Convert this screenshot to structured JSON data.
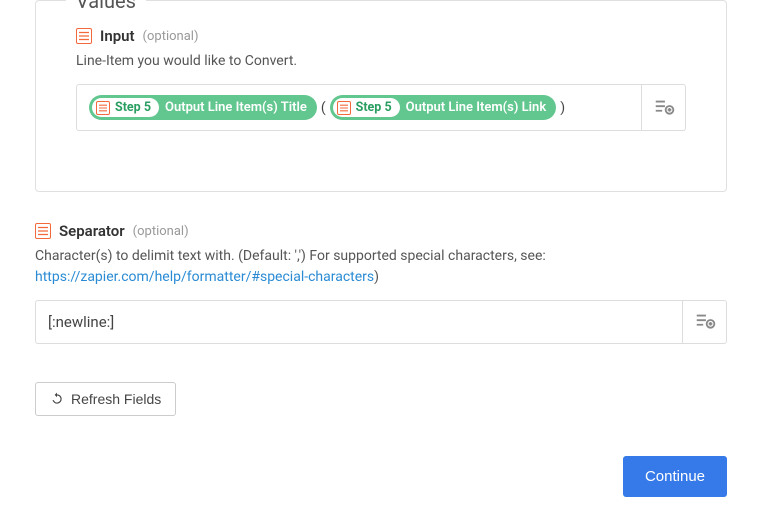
{
  "fieldset": {
    "legend": "Values"
  },
  "input_field": {
    "label": "Input",
    "optional": "(optional)",
    "description": "Line-Item you would like to Convert.",
    "tokens": [
      {
        "step": "Step 5",
        "label": "Output Line Item(s) Title"
      },
      {
        "step": "Step 5",
        "label": "Output Line Item(s) Link"
      }
    ],
    "open_paren": "(",
    "close_paren": ")"
  },
  "separator_field": {
    "label": "Separator",
    "optional": "(optional)",
    "description_prefix": "Character(s) to delimit text with. (Default: ',') For supported special characters, see: ",
    "link_text": "https://zapier.com/help/formatter/#special-characters",
    "description_suffix": ")",
    "value": "[:newline:]"
  },
  "refresh_label": "Refresh Fields",
  "continue_label": "Continue"
}
